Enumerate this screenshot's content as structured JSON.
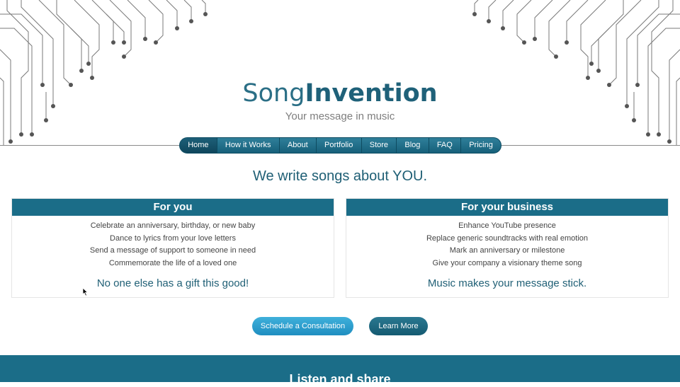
{
  "brand": {
    "name_regular": "Song",
    "name_bold": "Invention",
    "tagline": "Your message in music"
  },
  "nav": {
    "items": [
      "Home",
      "How it Works",
      "About",
      "Portfolio",
      "Store",
      "Blog",
      "FAQ",
      "Pricing"
    ],
    "active": "Home"
  },
  "headline": "We write songs about YOU.",
  "panels": [
    {
      "title": "For you",
      "items": [
        "Celebrate an anniversary, birthday, or new baby",
        "Dance to lyrics from your love letters",
        "Send a message of support to someone in need",
        "Commemorate the life of a loved one"
      ],
      "footer": "No one else has a gift this good!"
    },
    {
      "title": "For your business",
      "items": [
        "Enhance YouTube presence",
        "Replace generic soundtracks with real emotion",
        "Mark an anniversary or milestone",
        "Give your company a visionary theme song"
      ],
      "footer": "Music makes your message stick."
    }
  ],
  "buttons": {
    "consult": "Schedule a Consultation",
    "learn": "Learn More"
  },
  "section": {
    "title": "Listen and share"
  },
  "colors": {
    "primary": "#1b6d88",
    "accent": "#3fb0db",
    "logo": "#2b6f86"
  },
  "icons": [
    "circuit-music-decoration",
    "mouse-pointer-icon"
  ]
}
